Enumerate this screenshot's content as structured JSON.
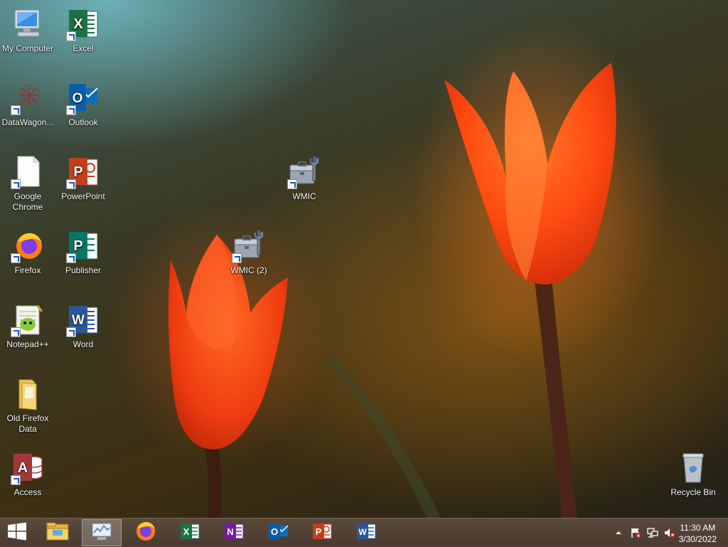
{
  "desktop_icons": [
    {
      "label": "My Computer",
      "icon": "computer-icon"
    },
    {
      "label": "Excel",
      "icon": "excel-icon"
    },
    {
      "label": "DataWagon...",
      "icon": "datawagon-icon"
    },
    {
      "label": "Outlook",
      "icon": "outlook-icon"
    },
    {
      "label": "Google Chrome",
      "icon": "blank-file-icon"
    },
    {
      "label": "PowerPoint",
      "icon": "powerpoint-icon"
    },
    {
      "label": "Firefox",
      "icon": "firefox-icon"
    },
    {
      "label": "Publisher",
      "icon": "publisher-icon"
    },
    {
      "label": "Notepad++",
      "icon": "notepadpp-icon"
    },
    {
      "label": "Word",
      "icon": "word-icon"
    },
    {
      "label": "Old Firefox Data",
      "icon": "folder-icon"
    },
    {
      "label": "Access",
      "icon": "access-icon"
    },
    {
      "label": "WMIC",
      "icon": "wmic-icon"
    },
    {
      "label": "WMIC (2)",
      "icon": "wmic-icon"
    },
    {
      "label": "Recycle Bin",
      "icon": "recycle-bin-icon"
    }
  ],
  "taskbar": {
    "apps": [
      {
        "name": "start",
        "icon": "windows-start-icon"
      },
      {
        "name": "file-explorer",
        "icon": "file-explorer-icon"
      },
      {
        "name": "system-monitor",
        "icon": "monitor-icon",
        "active": true
      },
      {
        "name": "firefox",
        "icon": "firefox-icon"
      },
      {
        "name": "excel",
        "icon": "excel-icon"
      },
      {
        "name": "onenote",
        "icon": "onenote-icon"
      },
      {
        "name": "outlook",
        "icon": "outlook-icon"
      },
      {
        "name": "powerpoint",
        "icon": "powerpoint-icon"
      },
      {
        "name": "word",
        "icon": "word-icon"
      }
    ],
    "tray": {
      "time": "11:30 AM",
      "date": "3/30/2022",
      "icons": [
        "show-hidden-icons-icon",
        "action-center-flag-icon",
        "network-icon",
        "volume-muted-icon"
      ]
    }
  },
  "colors": {
    "excel": "#1d7145",
    "outlook": "#0f6cbd",
    "powerpoint": "#c43e1c",
    "publisher": "#077568",
    "word": "#2b579a",
    "access": "#a4373a",
    "onenote": "#7719aa"
  }
}
